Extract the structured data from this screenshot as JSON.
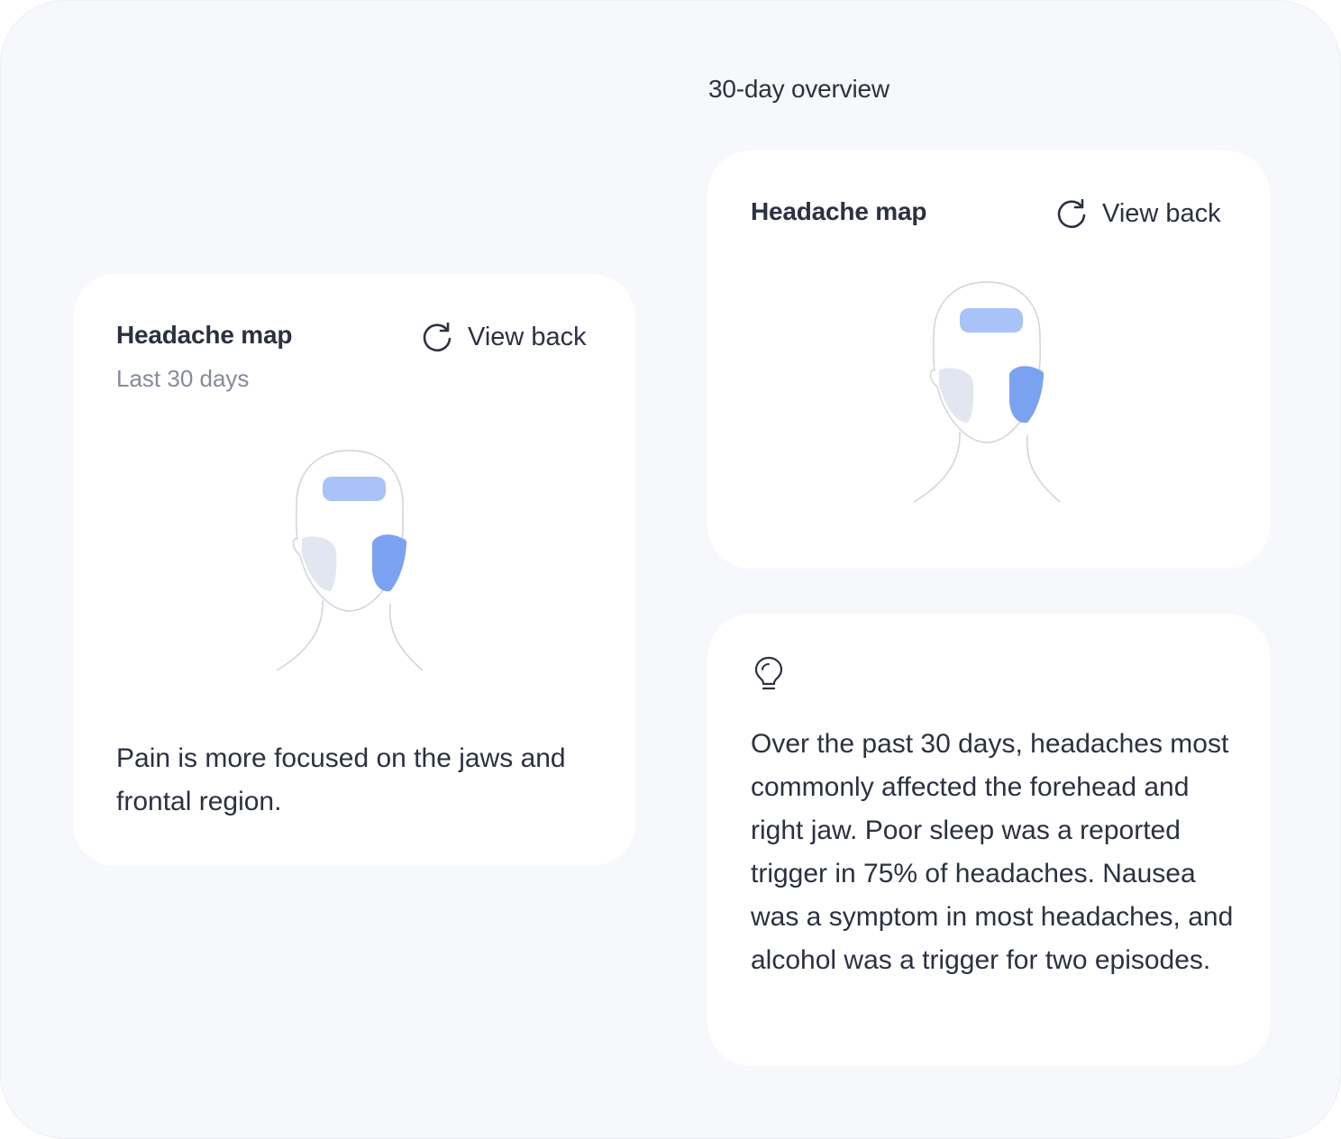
{
  "overview": {
    "title": "30-day overview"
  },
  "left_card": {
    "title": "Headache map",
    "subtitle": "Last 30 days",
    "view_back_label": "View back",
    "description": "Pain is more focused on the jaws and frontal region."
  },
  "map_card": {
    "title": "Headache map",
    "view_back_label": "View back"
  },
  "insight_card": {
    "icon": "lightbulb-icon",
    "text": "Over the past 30 days, headaches most commonly affected the forehead and right jaw. Poor sleep was a reported trigger in 75% of headaches. Nausea was a symptom in most headaches, and alcohol was a trigger for two episodes."
  },
  "colors": {
    "forehead": "#a9c2f7",
    "right_jaw": "#7ba1f1",
    "left_jaw": "#e1e6f1",
    "outline": "#cfd3dc"
  }
}
